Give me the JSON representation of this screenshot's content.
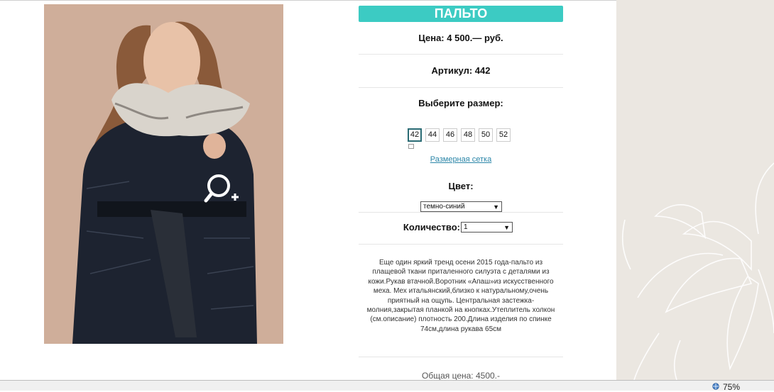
{
  "product": {
    "title": "ПАЛЬТО",
    "price": "Цена: 4 500.— руб.",
    "article": "Артикул: 442",
    "size_heading": "Выберите размер:",
    "sizes": [
      "42",
      "44",
      "46",
      "48",
      "50",
      "52"
    ],
    "selected_size": "42",
    "size_chart_link": "Размерная сетка",
    "color_heading": "Цвет:",
    "color_selected": "темно-синий",
    "quantity_label": "Количество:",
    "quantity_selected": "1",
    "description": "Еще один яркий тренд осени 2015 года-пальто из плащевой ткани приталенного силуэта с деталями из кожи.Рукав втачной.Воротник «Апаш»из искусственного меха. Мех итальянский,близко к натуральному,очень приятный на ощупь. Центральная застежка-молния,закрытая планкой на кнопках.Утеплитель холкон (см.описание) плотность 200.Длина изделия по спинке 74см,длина рукава 65см",
    "total": "Общая цена: 4500.-"
  },
  "status_bar": {
    "zoom": "75%"
  },
  "colors": {
    "accent": "#3ccbc3",
    "link": "#2b86a8",
    "coat": "#1d2330",
    "fur": "#d9d4cc"
  },
  "icons": {
    "zoom": "zoom-in-icon",
    "globe": "globe-icon"
  }
}
